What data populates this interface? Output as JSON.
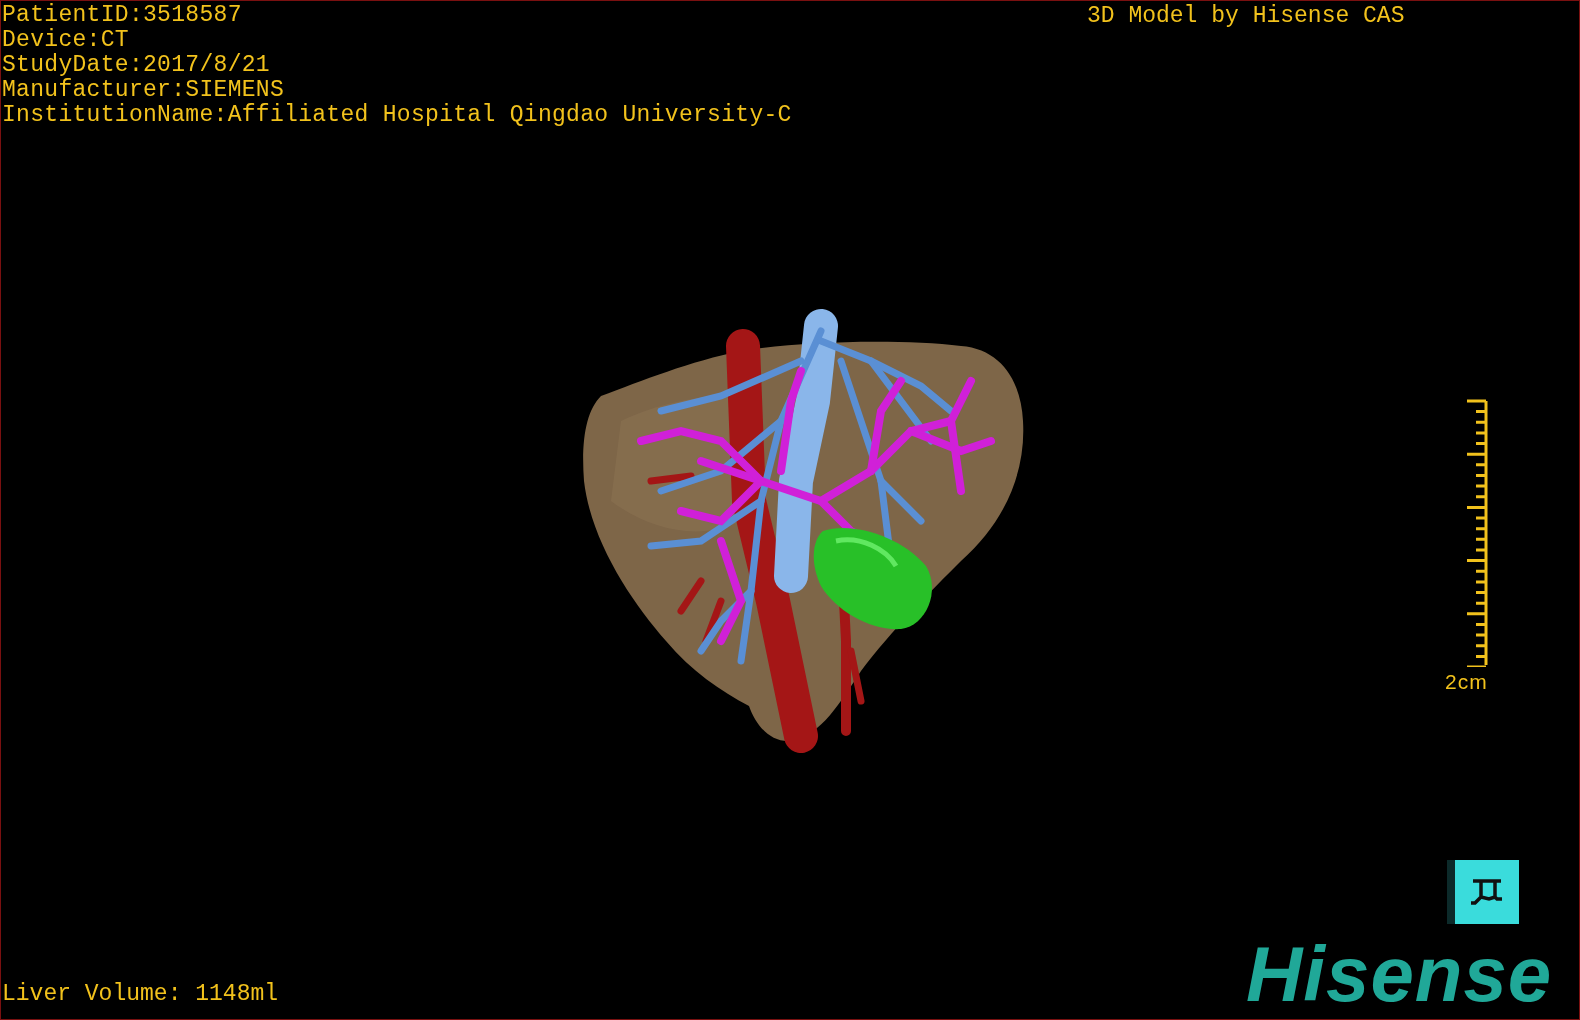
{
  "patient_info": [
    "PatientID:3518587",
    "Device:CT",
    "StudyDate:2017/8/21",
    "Manufacturer:SIEMENS",
    "InstitutionName:Affiliated Hospital Qingdao University-C"
  ],
  "caption": "3D Model by Hisense CAS",
  "scale_bar": {
    "label": "2cm"
  },
  "liver_volume": "Liver Volume: 1148ml",
  "logo": "Hisense"
}
